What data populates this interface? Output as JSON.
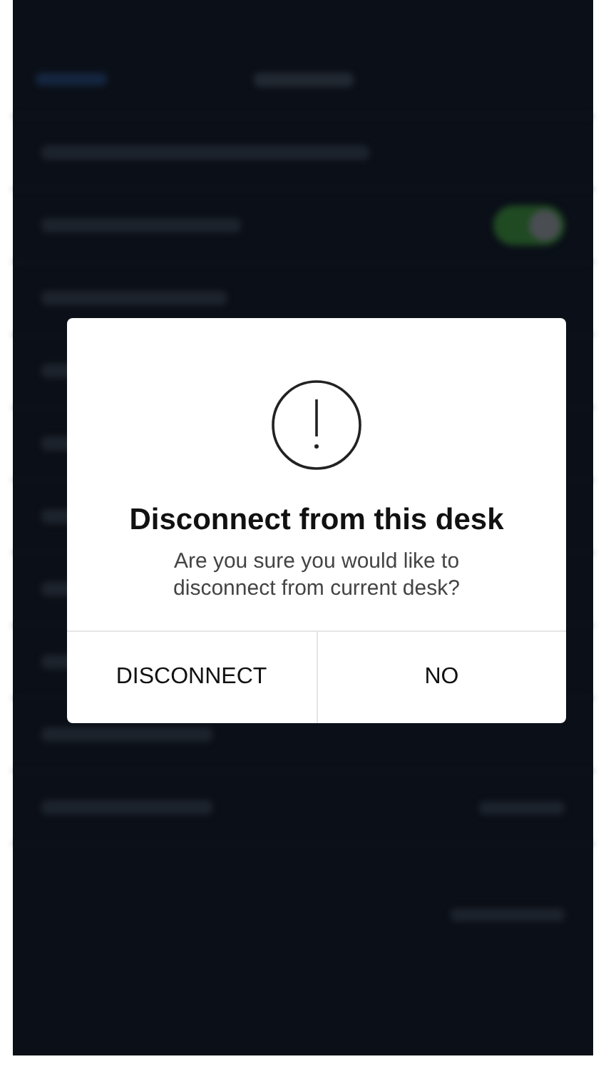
{
  "background": {
    "toggle": {
      "on": true
    }
  },
  "dialog": {
    "title": "Disconnect from this desk",
    "message": "Are you sure you would like to disconnect from current desk?",
    "buttons": [
      {
        "label": "DISCONNECT"
      },
      {
        "label": "NO"
      }
    ]
  }
}
